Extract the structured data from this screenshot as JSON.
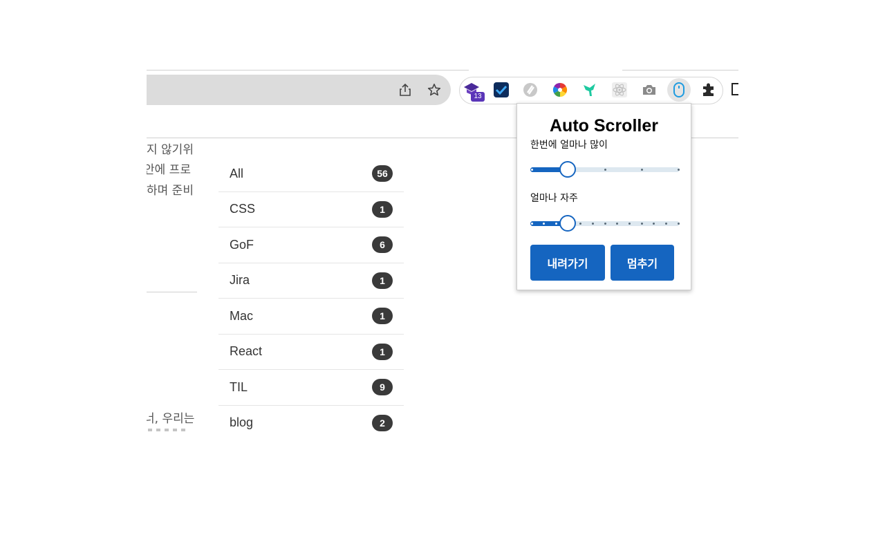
{
  "browser": {
    "share_icon": "share-icon",
    "bookmark_icon": "star-icon",
    "extensions": [
      {
        "name": "extension-graduation-cap",
        "badge": "13"
      },
      {
        "name": "extension-checkmark"
      },
      {
        "name": "extension-s-circle"
      },
      {
        "name": "extension-color-wheel"
      },
      {
        "name": "extension-bird"
      },
      {
        "name": "extension-react"
      },
      {
        "name": "extension-camera"
      },
      {
        "name": "extension-mouse",
        "active": true
      },
      {
        "name": "extensions-puzzle"
      }
    ]
  },
  "background_text": [
    "지 않기위",
    "안에 프로",
    "하며 준비",
    "너, 우리는"
  ],
  "tags": [
    {
      "label": "All",
      "count": "56"
    },
    {
      "label": "CSS",
      "count": "1"
    },
    {
      "label": "GoF",
      "count": "6"
    },
    {
      "label": "Jira",
      "count": "1"
    },
    {
      "label": "Mac",
      "count": "1"
    },
    {
      "label": "React",
      "count": "1"
    },
    {
      "label": "TIL",
      "count": "9"
    },
    {
      "label": "blog",
      "count": "2"
    }
  ],
  "popup": {
    "title": "Auto Scroller",
    "amount_label": "한번에 얼마나 많이",
    "amount_value": 0.25,
    "frequency_label": "얼마나 자주",
    "frequency_value": 0.25,
    "down_button": "내려가기",
    "stop_button": "멈추기"
  },
  "colors": {
    "accent": "#1565c0",
    "badge": "#3a3a3a"
  }
}
